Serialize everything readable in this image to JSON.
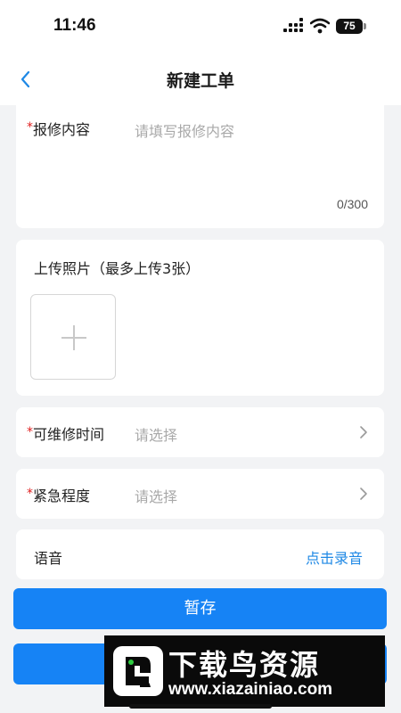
{
  "status_bar": {
    "time": "11:46",
    "battery": "75",
    "icons": [
      "signal-icon",
      "wifi-icon",
      "battery-icon"
    ]
  },
  "nav": {
    "title": "新建工单",
    "back_icon": "chevron-left-icon"
  },
  "form": {
    "content": {
      "required_mark": "*",
      "label": "报修内容",
      "placeholder": "请填写报修内容",
      "counter": "0/300"
    },
    "photos": {
      "label": "上传照片（最多上传3张）",
      "add_icon": "plus-icon"
    },
    "repair_time": {
      "required_mark": "*",
      "label": "可维修时间",
      "value": "请选择"
    },
    "urgency": {
      "required_mark": "*",
      "label": "紧急程度",
      "value": "请选择"
    },
    "voice": {
      "label": "语音",
      "action": "点击录音"
    }
  },
  "buttons": {
    "save": "暂存"
  },
  "watermark": {
    "title": "下载鸟资源",
    "url": "www.xiazainiao.com"
  },
  "colors": {
    "primary": "#1683f5",
    "link": "#1e88e5",
    "required": "#e02020",
    "background": "#f2f3f5"
  }
}
